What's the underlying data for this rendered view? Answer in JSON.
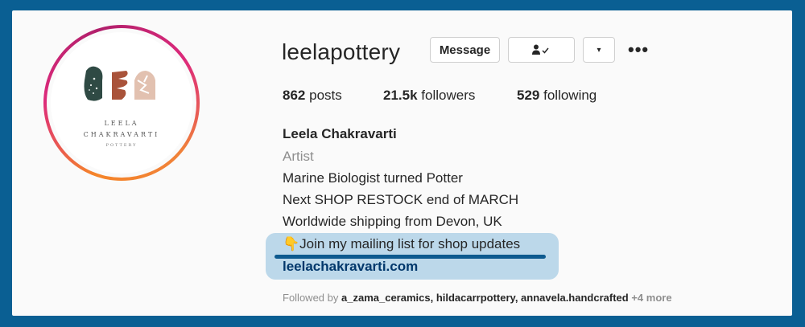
{
  "profile": {
    "username": "leelapottery",
    "avatar_text": {
      "line1": "LEELA",
      "line2": "CHAKRAVARTI",
      "line3": "POTTERY"
    }
  },
  "actions": {
    "message_label": "Message",
    "following_icon": "person-check-icon",
    "following_icon_text": "👤✓",
    "dropdown_icon": "▾",
    "more_icon": "•••"
  },
  "stats": {
    "posts_count": "862",
    "posts_label": "posts",
    "followers_count": "21.5k",
    "followers_label": "followers",
    "following_count": "529",
    "following_label": "following"
  },
  "bio": {
    "name": "Leela Chakravarti",
    "category": "Artist",
    "line1": "Marine Biologist turned Potter",
    "line2": "Next SHOP RESTOCK end of MARCH",
    "line3": "Worldwide shipping from Devon, UK",
    "line4": "👇Join my mailing list for shop updates",
    "link": "leelachakravarti.com"
  },
  "followed_by": {
    "prefix": "Followed by",
    "names": "a_zama_ceramics, hildacarrpottery, annavela.handcrafted",
    "more": "+4 more"
  },
  "colors": {
    "frame": "#0a5f93",
    "highlight": "#bcd8ea",
    "underline": "#0d5a8f",
    "link": "#00376b"
  }
}
